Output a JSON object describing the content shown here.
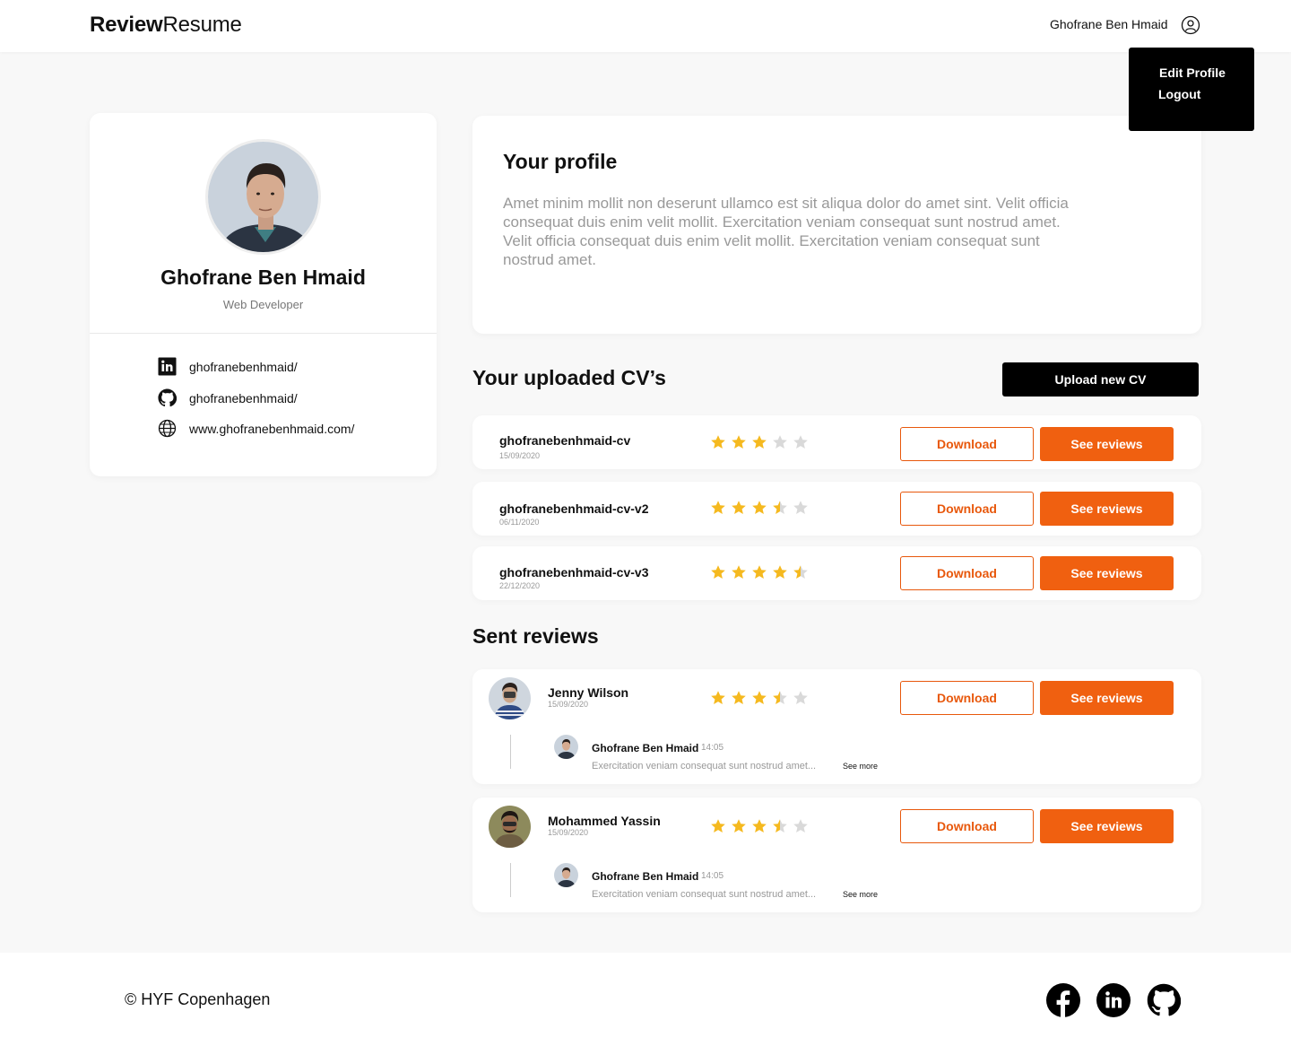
{
  "header": {
    "logo_bold": "Review",
    "logo_regular": "Resume",
    "user_name": "Ghofrane Ben Hmaid"
  },
  "dropdown": {
    "edit_profile": "Edit Profile",
    "logout": "Logout"
  },
  "profile_card": {
    "name": "Ghofrane Ben Hmaid",
    "role": "Web Developer",
    "links": [
      {
        "icon": "linkedin-icon",
        "text": "ghofranebenhmaid/"
      },
      {
        "icon": "github-icon",
        "text": "ghofranebenhmaid/"
      },
      {
        "icon": "globe-icon",
        "text": "www.ghofranebenhmaid.com/"
      }
    ]
  },
  "your_profile": {
    "title": "Your profile",
    "text": "Amet minim mollit non deserunt ullamco est sit aliqua dolor do amet sint. Velit officia consequat duis enim velit mollit. Exercitation veniam consequat sunt nostrud amet. Velit officia consequat duis enim velit mollit. Exercitation veniam consequat sunt nostrud amet."
  },
  "cvs": {
    "title": "Your uploaded CV’s",
    "upload_label": "Upload new CV",
    "items": [
      {
        "name": "ghofranebenhmaid-cv",
        "date": "15/09/2020",
        "rating": 3,
        "download": "Download",
        "see_reviews": "See reviews"
      },
      {
        "name": "ghofranebenhmaid-cv-v2",
        "date": "06/11/2020",
        "rating": 3.5,
        "download": "Download",
        "see_reviews": "See reviews"
      },
      {
        "name": "ghofranebenhmaid-cv-v3",
        "date": "22/12/2020",
        "rating": 4.5,
        "download": "Download",
        "see_reviews": "See reviews"
      }
    ]
  },
  "sent_reviews": {
    "title": "Sent reviews",
    "items": [
      {
        "name": "Jenny Wilson",
        "date": "15/09/2020",
        "rating": 3.5,
        "download": "Download",
        "see_reviews": "See reviews",
        "reply": {
          "name": "Ghofrane Ben Hmaid",
          "time": "14:05",
          "text": "Exercitation veniam consequat sunt nostrud amet...",
          "see_more": "See more"
        }
      },
      {
        "name": "Mohammed Yassin",
        "date": "15/09/2020",
        "rating": 3.5,
        "download": "Download",
        "see_reviews": "See reviews",
        "reply": {
          "name": "Ghofrane Ben Hmaid",
          "time": "14:05",
          "text": "Exercitation veniam consequat sunt nostrud amet...",
          "see_more": "See more"
        }
      }
    ]
  },
  "footer": {
    "copyright": "©  HYF Copenhagen",
    "icons": [
      "facebook-icon",
      "linkedin-icon",
      "github-icon"
    ]
  },
  "colors": {
    "accent": "#f06010",
    "star": "#f5b91f",
    "star_empty": "#d9d9d9"
  }
}
